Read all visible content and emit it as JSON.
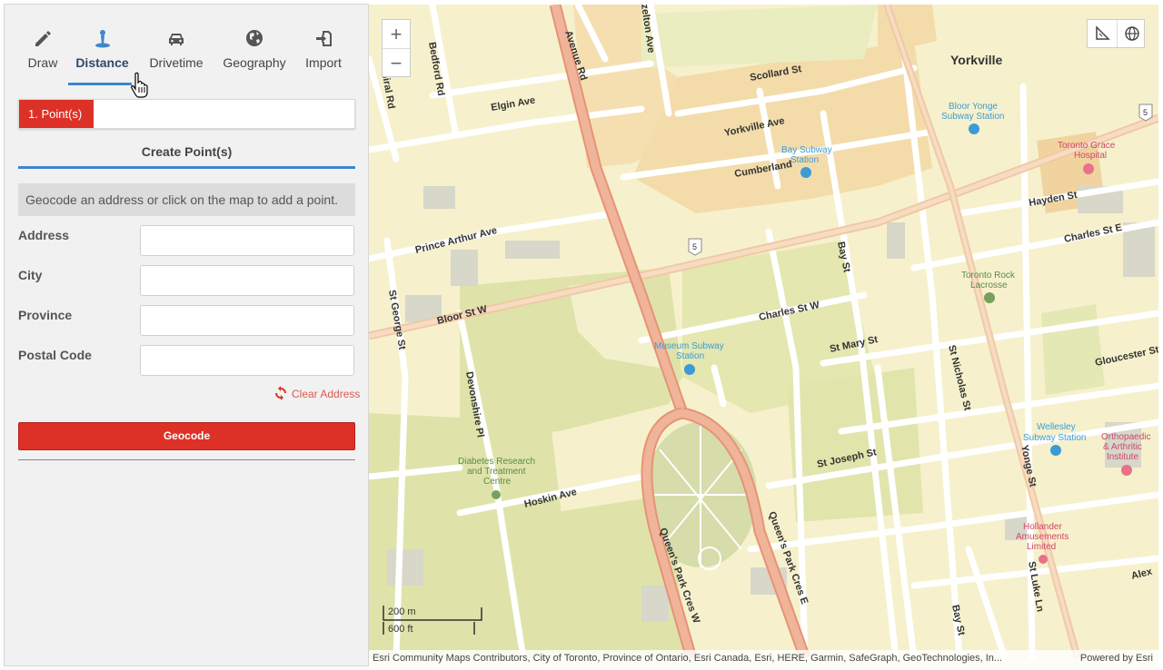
{
  "tabs": [
    {
      "label": "Draw",
      "icon": "pencil-icon"
    },
    {
      "label": "Distance",
      "icon": "pin-icon",
      "active": true
    },
    {
      "label": "Drivetime",
      "icon": "car-icon"
    },
    {
      "label": "Geography",
      "icon": "globe-icon"
    },
    {
      "label": "Import",
      "icon": "import-icon"
    }
  ],
  "step": {
    "badge": "1. Point(s)"
  },
  "section": {
    "title": "Create Point(s)"
  },
  "info": {
    "text": "Geocode an address or click on the map to add a point."
  },
  "form": {
    "address_label": "Address",
    "address_value": "",
    "city_label": "City",
    "city_value": "",
    "province_label": "Province",
    "province_value": "",
    "postal_label": "Postal Code",
    "postal_value": "",
    "clear_label": "Clear Address",
    "geocode_label": "Geocode"
  },
  "map": {
    "zoom_in": "+",
    "zoom_out": "−",
    "scale_m": "200 m",
    "scale_ft": "600 ft",
    "attribution": "Esri Community Maps Contributors, City of Toronto, Province of Ontario, Esri Canada, Esri, HERE, Garmin, SafeGraph, GeoTechnologies, In...",
    "powered_by": "Powered by Esri",
    "labels": {
      "yorkville": "Yorkville",
      "avenue_rd": "Avenue Rd",
      "hazelton_ave": "zelton Ave",
      "bedford_rd": "Bedford Rd",
      "admiral_rd": "miral Rd",
      "elgin_ave": "Elgin Ave",
      "scollard_st": "Scollard St",
      "yorkville_ave": "Yorkville Ave",
      "cumberland": "Cumberland",
      "hayden_st": "Hayden St",
      "charles_st_e": "Charles St E",
      "prince_arthur_ave": "Prince Arthur Ave",
      "bloor_st_w": "Bloor St W",
      "st_george_st": "St George St",
      "bay_st": "Bay St",
      "bay_st_2": "Bay St",
      "charles_st_w": "Charles St W",
      "st_mary_st": "St Mary St",
      "st_nicholas_st": "St Nicholas St",
      "gloucester_st": "Gloucester St",
      "devonshire_pl": "Devonshire Pl",
      "hoskin_ave": "Hoskin Ave",
      "st_joseph_st": "St Joseph St",
      "yonge_st": "Yonge St",
      "queens_park_cres_w": "Queen's Park Cres W",
      "queens_park_cres_e": "Queen's Park Cres E",
      "st_luke_ln": "St Luke Ln",
      "alex": "Alex",
      "route_5": "5"
    },
    "pois": {
      "bloor_yonge_1": "Bloor Yonge",
      "bloor_yonge_2": "Subway Station",
      "bay_subway_1": "Bay Subway",
      "bay_subway_2": "Station",
      "toronto_grace_1": "Toronto Grace",
      "toronto_grace_2": "Hospital",
      "rock_lacrosse_1": "Toronto Rock",
      "rock_lacrosse_2": "Lacrosse",
      "museum_1": "Museum Subway",
      "museum_2": "Station",
      "wellesley_1": "Wellesley",
      "wellesley_2": "Subway Station",
      "ortho_1": "Orthopaedic",
      "ortho_2": "& Arthritic",
      "ortho_3": "Institute",
      "diabetes_1": "Diabetes Research",
      "diabetes_2": "and Treatment",
      "diabetes_3": "Centre",
      "hollander_1": "Hollander",
      "hollander_2": "Amusements",
      "hollander_3": "Limited"
    }
  }
}
